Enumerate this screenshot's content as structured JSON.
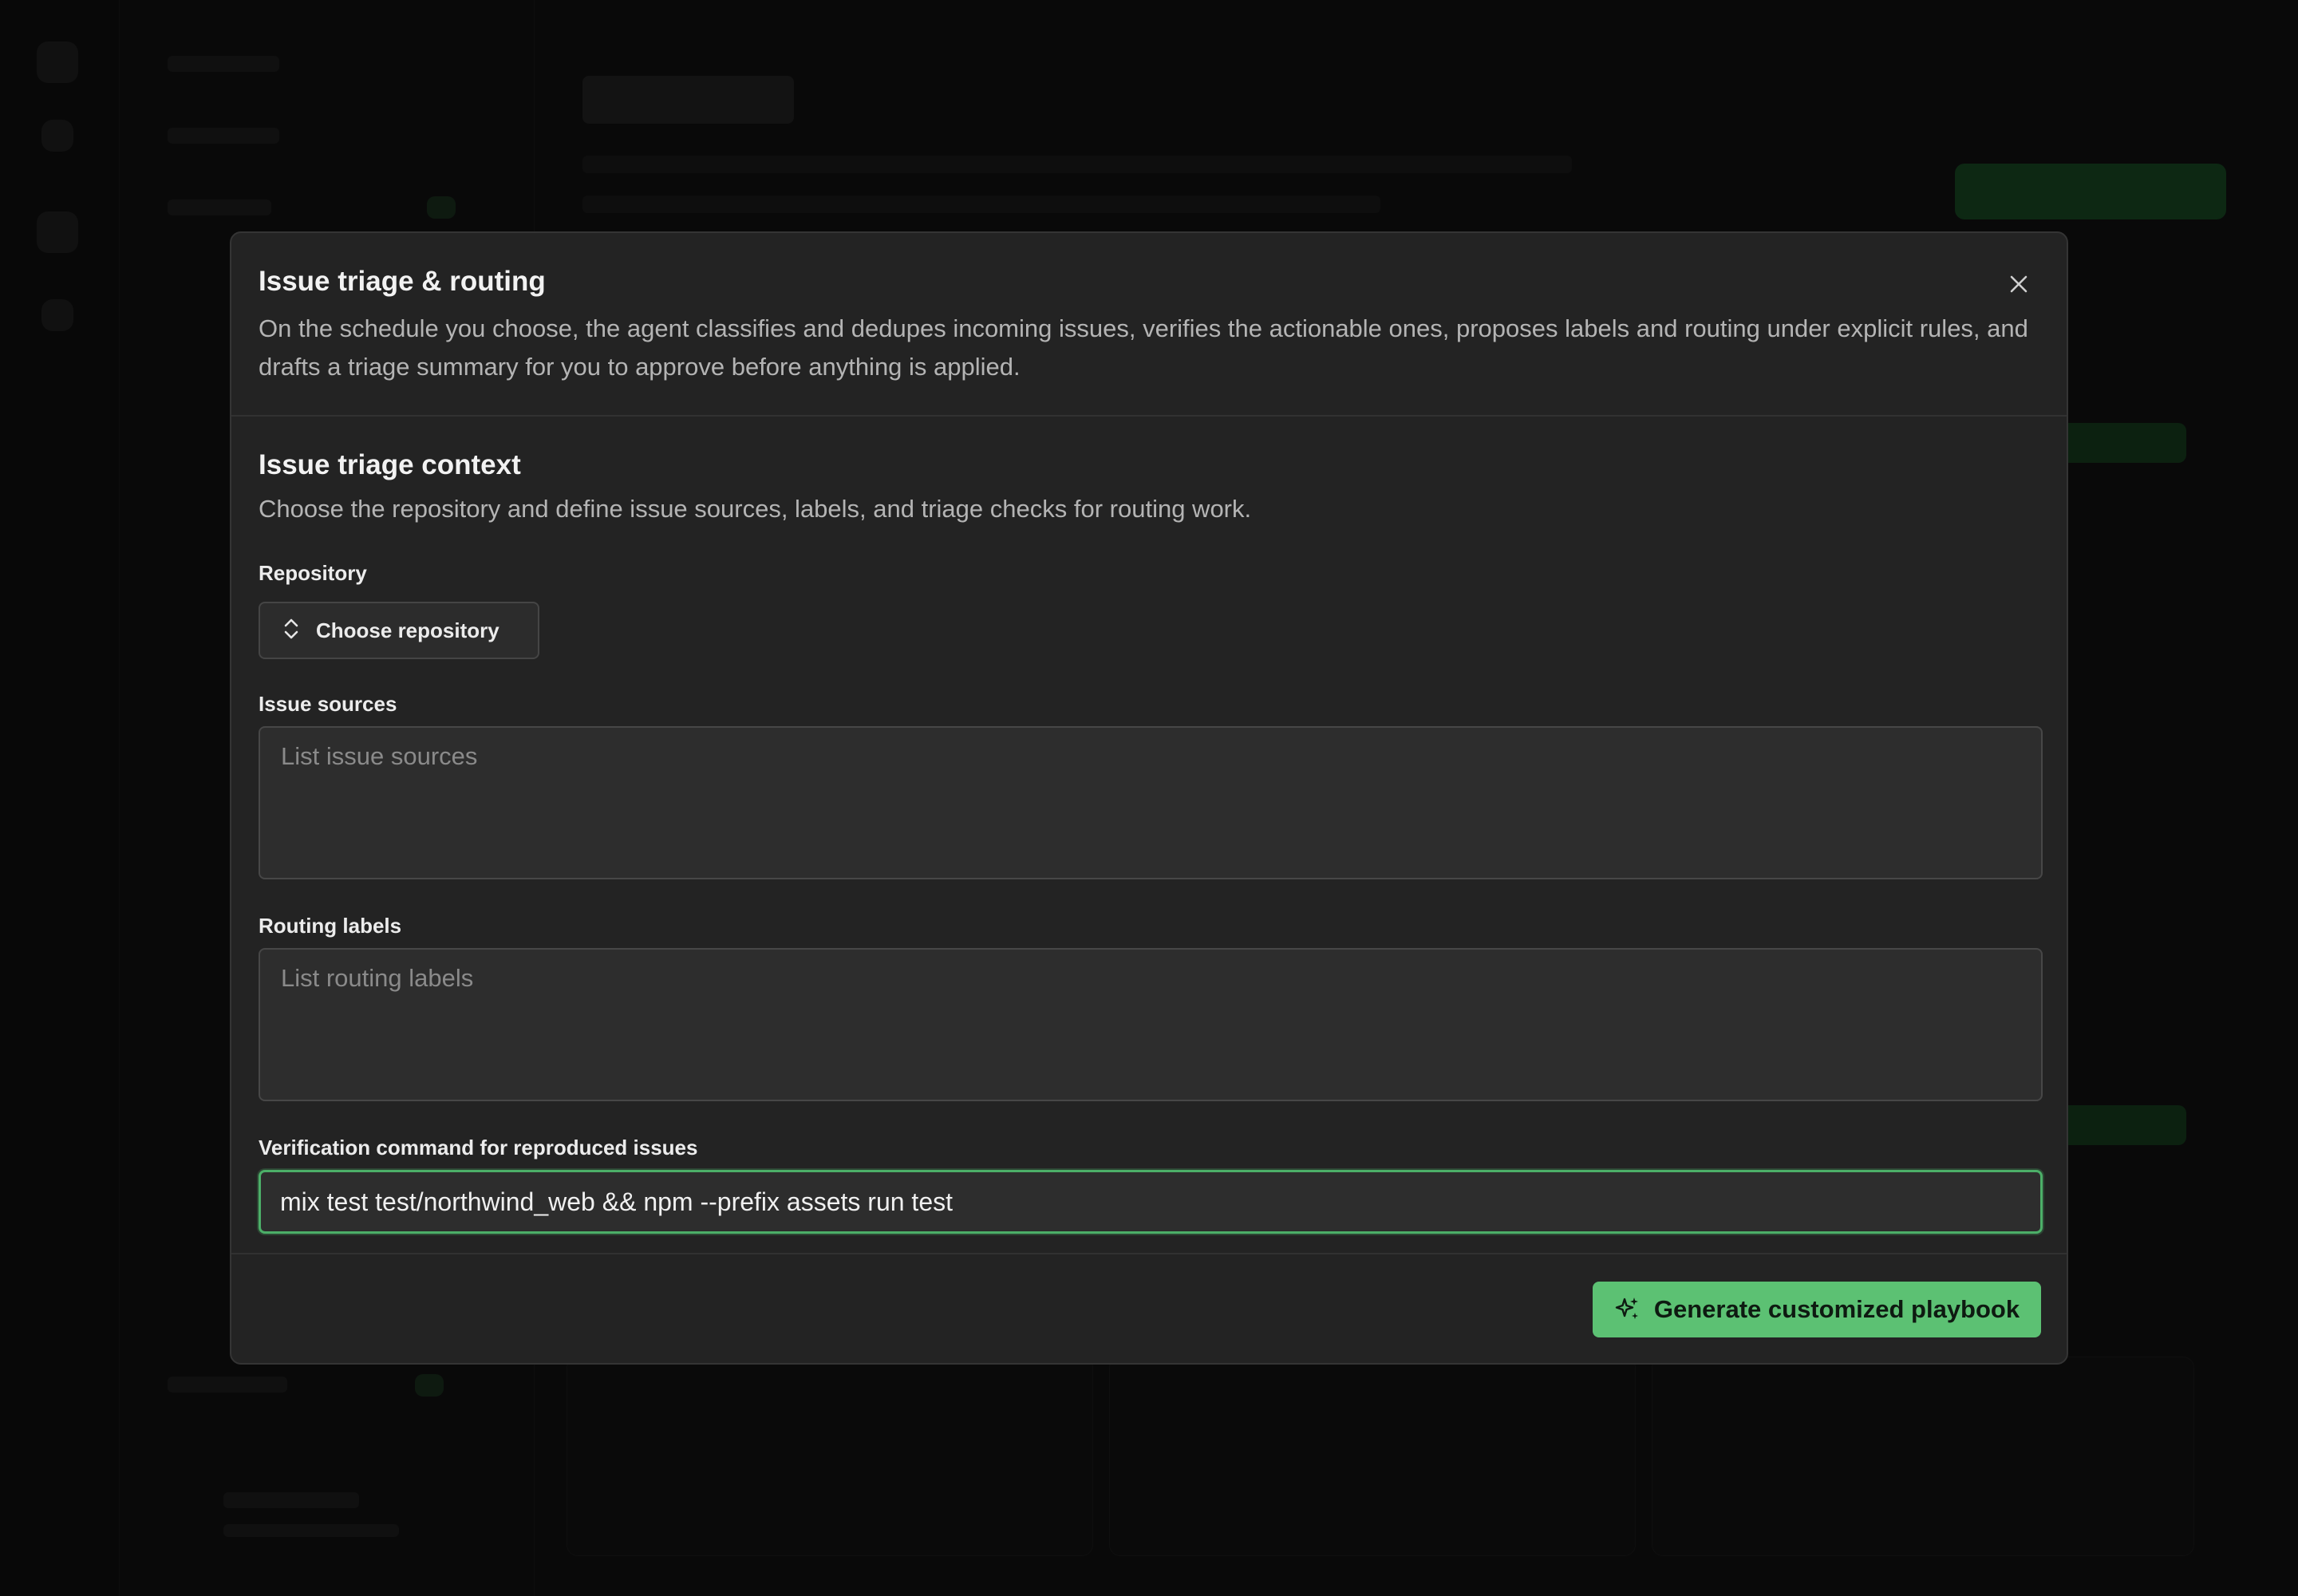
{
  "modal": {
    "title": "Issue triage & routing",
    "description": "On the schedule you choose, the agent classifies and dedupes incoming issues, verifies the actionable ones, proposes labels and routing under explicit rules, and drafts a triage summary for you to approve before anything is applied.",
    "close_icon": "close-icon"
  },
  "context": {
    "title": "Issue triage context",
    "description": "Choose the repository and define issue sources, labels, and triage checks for routing work."
  },
  "fields": {
    "repository": {
      "label": "Repository",
      "button_label": "Choose repository",
      "icon": "chevron-up-down-icon"
    },
    "issue_sources": {
      "label": "Issue sources",
      "placeholder": "List issue sources",
      "value": ""
    },
    "routing_labels": {
      "label": "Routing labels",
      "placeholder": "List routing labels",
      "value": ""
    },
    "verification_command": {
      "label": "Verification command for reproduced issues",
      "value": "mix test test/northwind_web && npm --prefix assets run test"
    }
  },
  "footer": {
    "generate_label": "Generate customized playbook",
    "generate_icon": "sparkles-icon"
  },
  "colors": {
    "accent": "#5cc173",
    "focus_border": "#4caf68",
    "modal_bg": "#232323",
    "backdrop": "#0b0b0b"
  }
}
